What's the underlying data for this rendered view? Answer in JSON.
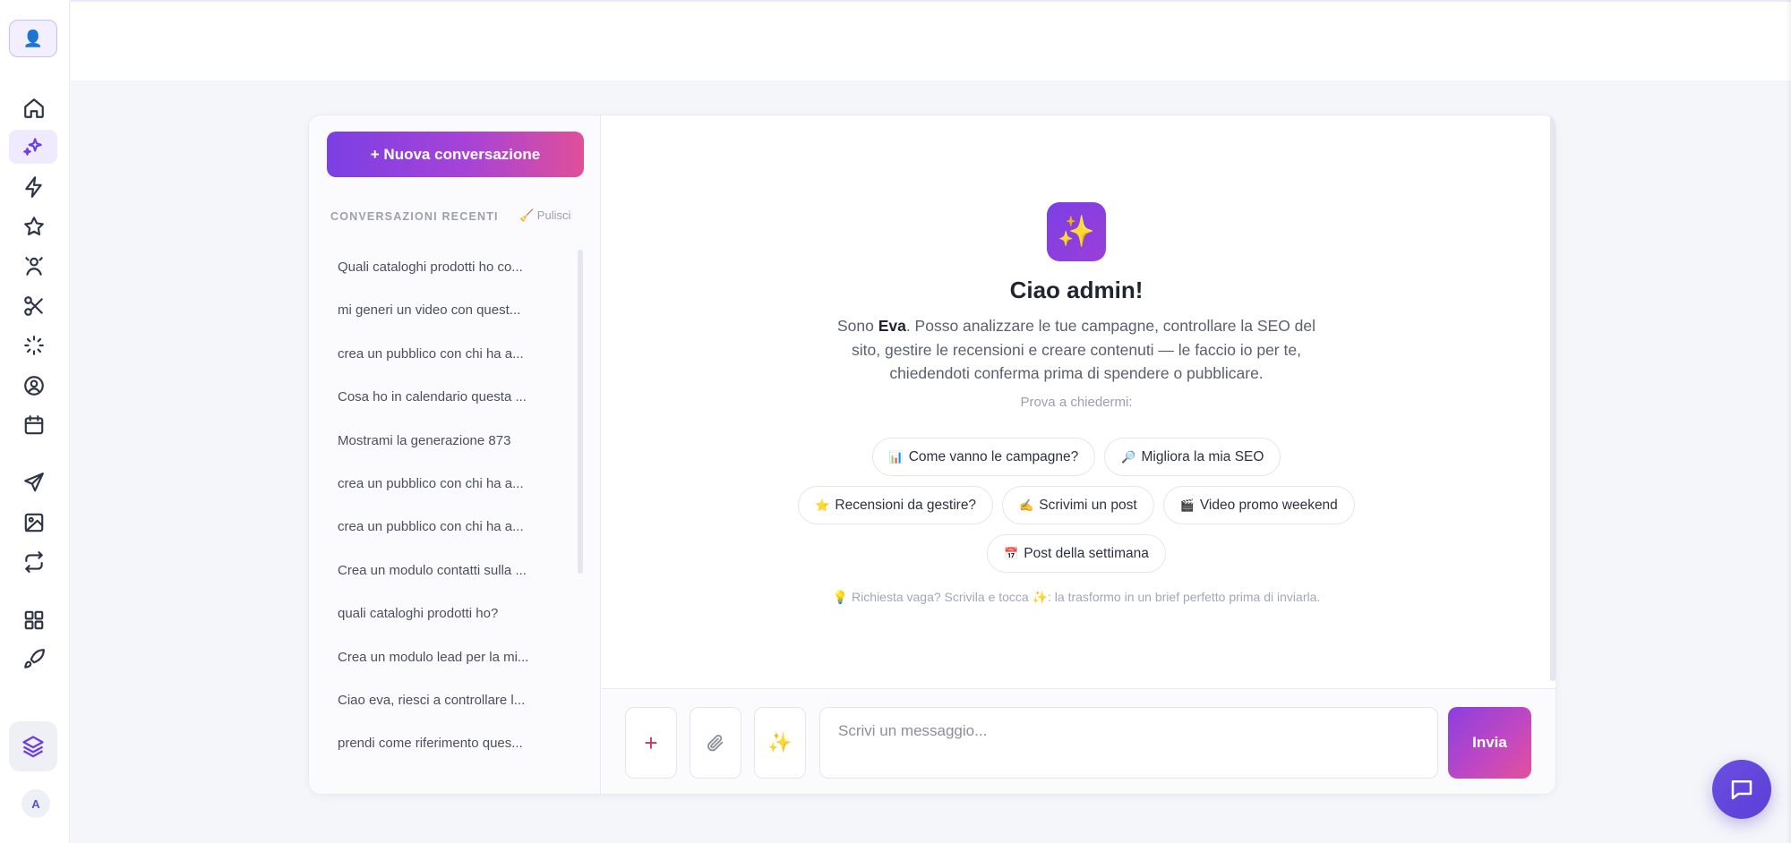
{
  "rail": {
    "top_avatar_icon": "user-icon",
    "items": [
      {
        "icon": "home-icon"
      },
      {
        "icon": "sparkles-icon",
        "active": true
      },
      {
        "icon": "bolt-icon"
      },
      {
        "icon": "star-icon"
      },
      {
        "icon": "audience-icon"
      },
      {
        "icon": "scissors-icon"
      },
      {
        "icon": "loader-icon"
      },
      {
        "icon": "user-circle-icon"
      },
      {
        "icon": "calendar-icon"
      },
      {
        "icon": "send-icon"
      },
      {
        "icon": "image-icon"
      },
      {
        "icon": "repeat-icon"
      },
      {
        "icon": "grid-icon"
      },
      {
        "icon": "rocket-icon"
      }
    ],
    "bottom_icon": "layers-icon",
    "user_initial": "A"
  },
  "sidebar": {
    "new_conversation_label": "+ Nuova conversazione",
    "recent_title": "CONVERSAZIONI RECENTI",
    "clear_label": "🧹 Pulisci",
    "conversations": [
      "Quali cataloghi prodotti ho co...",
      "mi generi un video con quest...",
      "crea un pubblico con chi ha a...",
      "Cosa ho in calendario questa ...",
      "Mostrami la generazione 873",
      "crea un pubblico con chi ha a...",
      "crea un pubblico con chi ha a...",
      "Crea un modulo contatti sulla ...",
      "quali cataloghi prodotti ho?",
      "Crea un modulo lead per la mi...",
      "Ciao eva, riesci a controllare l...",
      "prendi come riferimento ques..."
    ]
  },
  "welcome": {
    "icon": "✨",
    "title": "Ciao admin!",
    "text_prefix": "Sono ",
    "assistant_name": "Eva",
    "text_suffix": ". Posso analizzare le tue campagne, controllare la SEO del sito, gestire le recensioni e creare contenuti — le faccio io per te, chiedendoti conferma prima di spendere o pubblicare.",
    "try_label": "Prova a chiedermi:",
    "suggestions_row1": [
      {
        "icon": "📊",
        "label": "Come vanno le campagne?"
      },
      {
        "icon": "🔎",
        "label": "Migliora la mia SEO"
      }
    ],
    "suggestions_row2": [
      {
        "icon": "⭐",
        "label": "Recensioni da gestire?"
      },
      {
        "icon": "✍️",
        "label": "Scrivimi un post"
      },
      {
        "icon": "🎬",
        "label": "Video promo weekend"
      }
    ],
    "suggestions_row3": [
      {
        "icon": "📅",
        "label": "Post della settimana"
      }
    ],
    "hint": "💡 Richiesta vaga? Scrivila e tocca ✨: la trasformo in un brief perfetto prima di inviarla."
  },
  "composer": {
    "add_symbol": "+",
    "enhance_symbol": "✨",
    "placeholder": "Scrivi un messaggio...",
    "send_label": "Invia"
  },
  "colors": {
    "accent": "#7b3fe4",
    "accent_pink": "#e04f9a",
    "fab": "#6a4fe0"
  }
}
